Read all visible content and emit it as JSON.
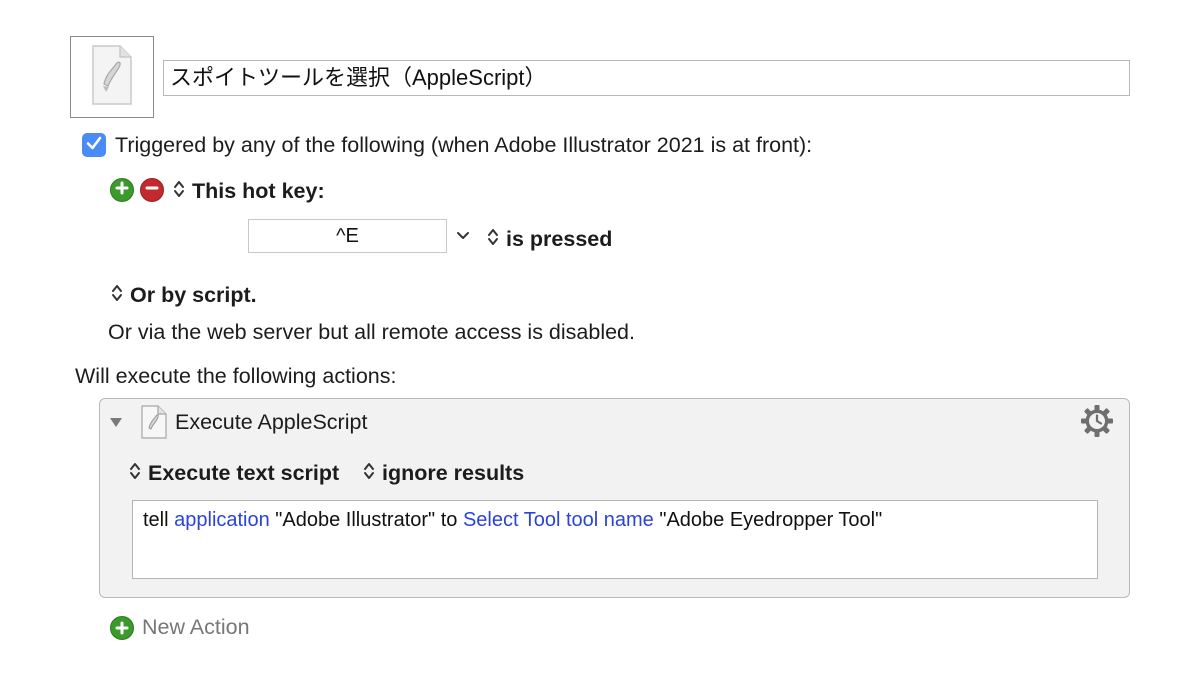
{
  "macro": {
    "icon": "applescript-document-icon",
    "title": "スポイトツールを選択（AppleScript）"
  },
  "trigger": {
    "checked": true,
    "label": "Triggered by any of the following (when Adobe Illustrator 2021 is at front):",
    "hotkey_label": "This hot key:",
    "hotkey_value": "^E",
    "pressed_label": "is pressed",
    "script_label": "Or by script.",
    "web_server_text": "Or via the web server but all remote access is disabled."
  },
  "actions": {
    "heading": "Will execute the following actions:",
    "items": [
      {
        "title": "Execute AppleScript",
        "mode": "Execute text script",
        "results": "ignore results",
        "script": {
          "t1": "tell ",
          "k1": "application",
          "t2": " \"Adobe Illustrator\" to ",
          "k2": "Select Tool tool name",
          "t3": " \"Adobe Eyedropper Tool\""
        }
      }
    ],
    "new_action_label": "New Action"
  },
  "colors": {
    "checkbox": "#4a8cf6",
    "add": "#3c9a2c",
    "remove": "#c42a2d",
    "keyword": "#2a43d9"
  }
}
